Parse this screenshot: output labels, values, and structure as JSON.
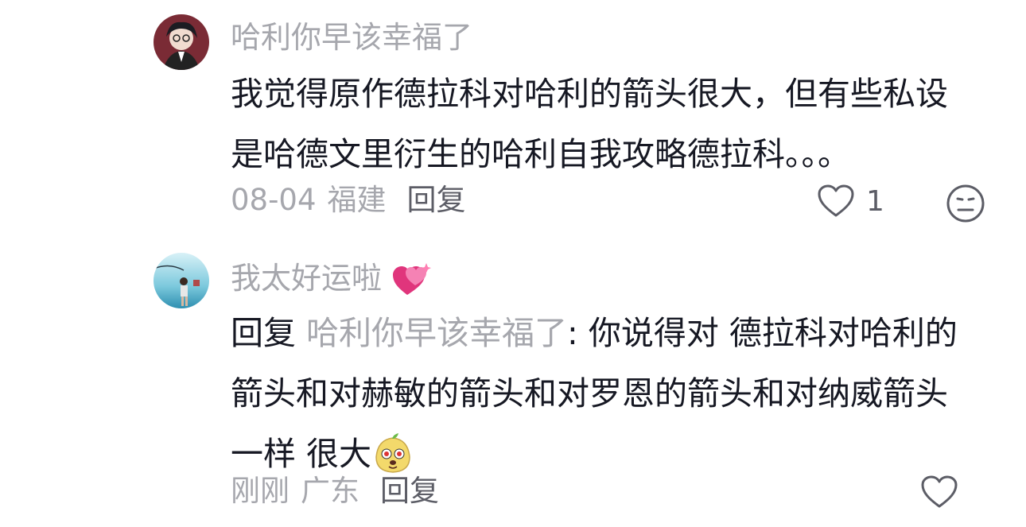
{
  "comments": [
    {
      "username": "哈利你早该幸福了",
      "text": "我觉得原作德拉科对哈利的箭头很大，但有些私设是哈德文里衍生的哈利自我攻略德拉科。。。",
      "date": "08-04",
      "location": "福建",
      "reply_label": "回复",
      "like_count": "1"
    },
    {
      "username": "我太好运啦",
      "reply_prefix": "回复",
      "reply_target": "哈利你早该幸福了",
      "text_a": ": 你说得对 德拉科对哈利的箭头和对赫敏的箭头和对罗恩的箭头和对纳威箭头一样 很大",
      "date": "刚刚",
      "location": "广东",
      "reply_label": "回复"
    }
  ],
  "icons": {
    "like": "heart-outline-icon",
    "dislike": "neutral-face-icon",
    "username_emoji": "sparkling-heart-emoji",
    "body_emoji": "doge-face-emoji"
  },
  "colors": {
    "primary_text": "#161823",
    "secondary_text": "#a6a7ad",
    "action_text": "#5c5d66"
  }
}
